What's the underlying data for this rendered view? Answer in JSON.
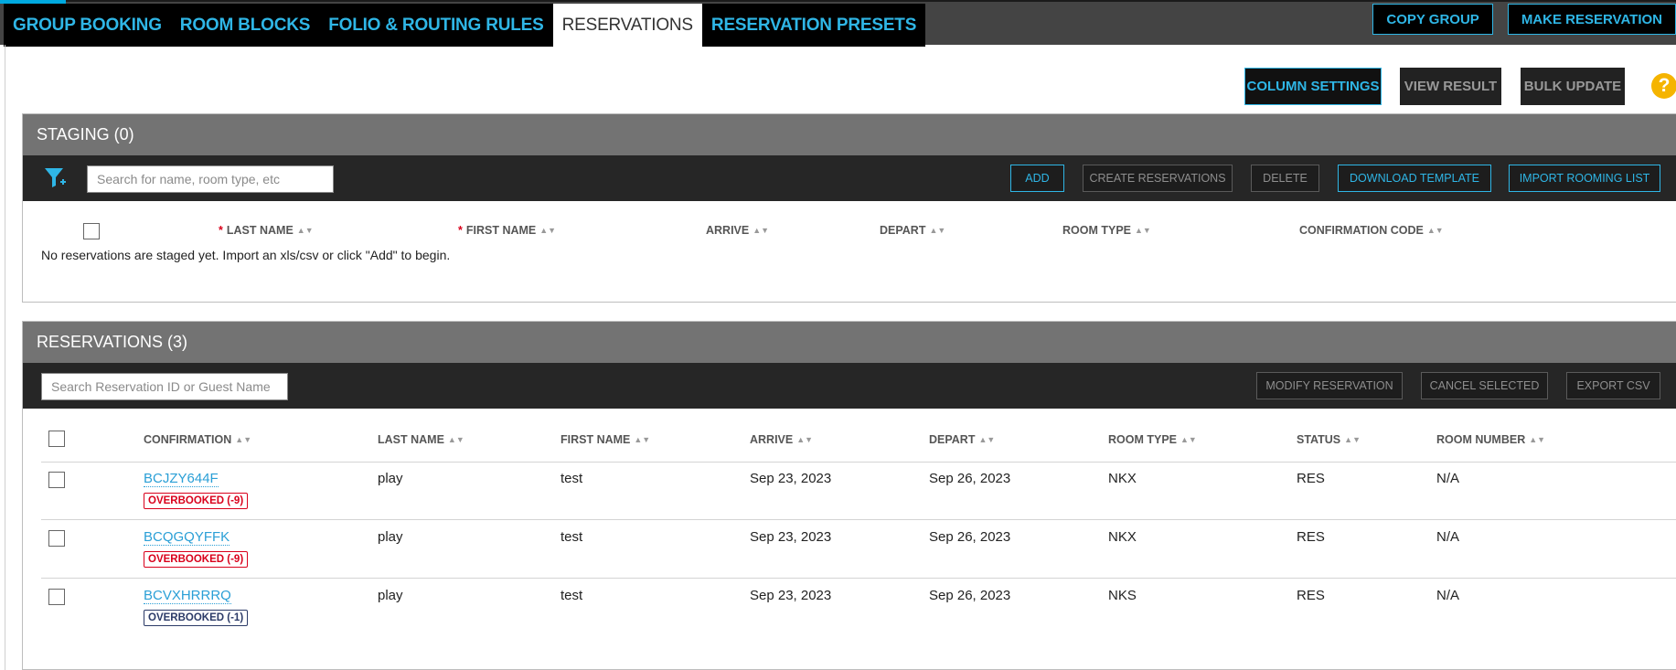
{
  "nav": {
    "tabs": [
      {
        "label": "GROUP BOOKING"
      },
      {
        "label": "ROOM BLOCKS"
      },
      {
        "label": "FOLIO & ROUTING RULES"
      },
      {
        "label": "RESERVATIONS"
      },
      {
        "label": "RESERVATION PRESETS"
      }
    ],
    "active_tab": "RESERVATIONS",
    "actions": {
      "copy_group": "COPY GROUP",
      "make_reservation": "MAKE RESERVATION"
    }
  },
  "toolbar": {
    "column_settings": "COLUMN SETTINGS",
    "view_result": "VIEW RESULT",
    "bulk_update": "BULK UPDATE",
    "help": "?"
  },
  "staging": {
    "title": "STAGING (0)",
    "search_placeholder": "Search for name, room type, etc",
    "buttons": {
      "add": "ADD",
      "create": "CREATE RESERVATIONS",
      "delete": "DELETE",
      "download": "DOWNLOAD TEMPLATE",
      "import": "IMPORT ROOMING LIST"
    },
    "columns": {
      "last_name": "LAST NAME",
      "first_name": "FIRST NAME",
      "arrive": "ARRIVE",
      "depart": "DEPART",
      "room_type": "ROOM TYPE",
      "confirmation_code": "CONFIRMATION CODE"
    },
    "required_mark": "*",
    "empty_message": "No reservations are staged yet. Import an xls/csv or click \"Add\" to begin."
  },
  "reservations": {
    "title": "RESERVATIONS (3)",
    "search_placeholder": "Search Reservation ID or Guest Name",
    "buttons": {
      "modify": "MODIFY RESERVATION",
      "cancel": "CANCEL SELECTED",
      "export": "EXPORT CSV"
    },
    "columns": {
      "confirmation": "CONFIRMATION",
      "last_name": "LAST NAME",
      "first_name": "FIRST NAME",
      "arrive": "ARRIVE",
      "depart": "DEPART",
      "room_type": "ROOM TYPE",
      "status": "STATUS",
      "room_number": "ROOM NUMBER"
    },
    "rows": [
      {
        "confirmation": "BCJZY644F",
        "badge": "OVERBOOKED (-9)",
        "last_name": "play",
        "first_name": "test",
        "arrive": "Sep 23, 2023",
        "depart": "Sep 26, 2023",
        "room_type": "NKX",
        "status": "RES",
        "room_number": "N/A"
      },
      {
        "confirmation": "BCQGQYFFK",
        "badge": "OVERBOOKED (-9)",
        "last_name": "play",
        "first_name": "test",
        "arrive": "Sep 23, 2023",
        "depart": "Sep 26, 2023",
        "room_type": "NKX",
        "status": "RES",
        "room_number": "N/A"
      },
      {
        "confirmation": "BCVXHRRRQ",
        "badge": "OVERBOOKED (-1)",
        "last_name": "play",
        "first_name": "test",
        "arrive": "Sep 23, 2023",
        "depart": "Sep 26, 2023",
        "room_type": "NKS",
        "status": "RES",
        "room_number": "N/A"
      }
    ]
  },
  "colors": {
    "accent": "#2fb6e6",
    "overbooked_severe": "#d9001b",
    "overbooked_mild": "#2b3a67",
    "help": "#f5b400"
  }
}
